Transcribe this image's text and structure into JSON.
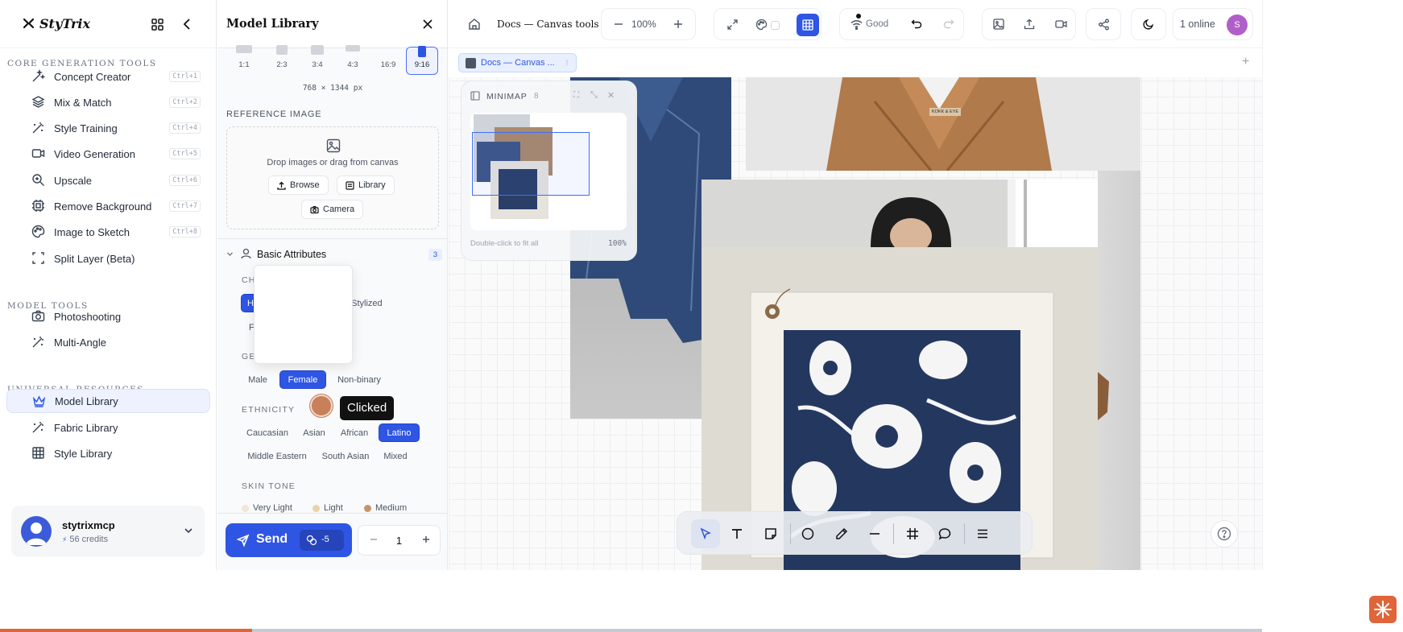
{
  "app": {
    "name": "StyTrix"
  },
  "sidebar": {
    "sections": [
      {
        "title": "CORE GENERATION TOOLS",
        "items": [
          {
            "label": "Concept Creator",
            "shortcut": "Ctrl+1",
            "icon": "wand-icon"
          },
          {
            "label": "Mix & Match",
            "shortcut": "Ctrl+2",
            "icon": "layers-icon"
          },
          {
            "label": "Style Training",
            "shortcut": "Ctrl+4",
            "icon": "magic-wand-icon"
          },
          {
            "label": "Video Generation",
            "shortcut": "Ctrl+5",
            "icon": "video-icon"
          },
          {
            "label": "Upscale",
            "shortcut": "Ctrl+6",
            "icon": "zoom-in-icon"
          },
          {
            "label": "Remove Background",
            "shortcut": "Ctrl+7",
            "icon": "scan-icon"
          },
          {
            "label": "Image to Sketch",
            "shortcut": "Ctrl+8",
            "icon": "palette-icon"
          },
          {
            "label": "Split Layer (Beta)",
            "shortcut": "",
            "icon": "split-icon"
          }
        ]
      },
      {
        "title": "MODEL TOOLS",
        "items": [
          {
            "label": "Photoshooting",
            "shortcut": "",
            "icon": "camera-icon"
          },
          {
            "label": "Multi-Angle",
            "shortcut": "",
            "icon": "magic-wand-icon"
          }
        ]
      },
      {
        "title": "UNIVERSAL RESOURCES",
        "items": [
          {
            "label": "Model Library",
            "shortcut": "",
            "icon": "crown-icon",
            "active": true
          },
          {
            "label": "Fabric Library",
            "shortcut": "",
            "icon": "magic-wand-icon"
          },
          {
            "label": "Style Library",
            "shortcut": "",
            "icon": "grid-icon"
          }
        ]
      }
    ],
    "user": {
      "name": "stytrixmcp",
      "credits": "56 credits"
    }
  },
  "panel": {
    "title": "Model Library",
    "aspect_ratios": [
      {
        "label": "1:1",
        "selected": false
      },
      {
        "label": "2:3",
        "selected": false
      },
      {
        "label": "3:4",
        "selected": false
      },
      {
        "label": "4:3",
        "selected": false
      },
      {
        "label": "16:9",
        "selected": false
      },
      {
        "label": "9:16",
        "selected": true
      }
    ],
    "dimensions": "768 × 1344 px",
    "reference_image": {
      "label": "REFERENCE IMAGE",
      "hint": "Drop images or drag from canvas",
      "browse": "Browse",
      "library": "Library",
      "camera": "Camera"
    },
    "basic_attributes": {
      "title": "Basic Attributes",
      "count": "3",
      "char_label_partial": "CH",
      "char_first_partial": "H",
      "char_second": "Stylized",
      "char_row2_partial": "F",
      "gender_label_partial": "GE",
      "gender": [
        "Male",
        "Female",
        "Non-binary"
      ],
      "gender_selected": "Female",
      "ethnicity_label": "ETHNICITY",
      "ethnicity": [
        "Caucasian",
        "Asian",
        "African",
        "Latino",
        "Middle Eastern",
        "South Asian",
        "Mixed"
      ],
      "ethnicity_selected": "Latino",
      "skin_tone_label": "SKIN TONE",
      "skin_tones": [
        {
          "label": "Very Light",
          "color": "#ece7d6"
        },
        {
          "label": "Light",
          "color": "#e8d2a8"
        },
        {
          "label": "Medium",
          "color": "#c8926a"
        }
      ]
    },
    "tooltip": "Clicked",
    "cursor_color": "#c8805a",
    "send": {
      "label": "Send",
      "cost": "-5"
    },
    "quantity": "1"
  },
  "topbar": {
    "doc_title": "Docs — Canvas tools",
    "zoom": "100%",
    "connection": "Good",
    "online": "1 online",
    "presence_initial": "S",
    "presence_color": "#b15fc8"
  },
  "canvas": {
    "tab_label": "Docs — Canvas ...",
    "minimap": {
      "title": "MINIMAP",
      "count": "8",
      "hint": "Double-click to fit all",
      "zoom": "100%"
    },
    "coat_label": "KOKK & EYE"
  },
  "colors": {
    "accent": "#2f55e4",
    "brand_orange": "#e0653a"
  },
  "progress": {
    "fraction": 0.2
  }
}
